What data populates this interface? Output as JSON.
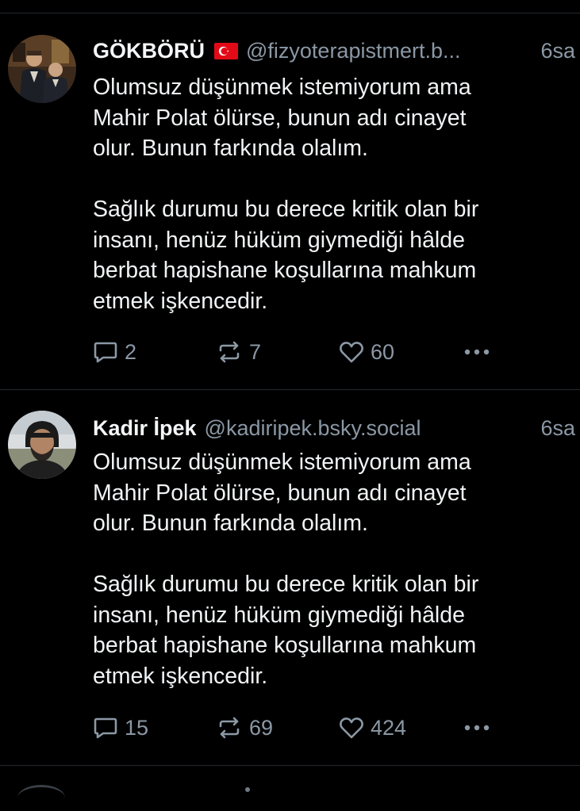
{
  "colors": {
    "background": "#000000",
    "text": "#f1f3f5",
    "muted": "#8b98a5",
    "divider": "#23282d"
  },
  "posts": [
    {
      "author_name": "GÖKBÖRÜ",
      "author_flag": "turkey-flag-icon",
      "handle": "@fizyoterapistmert.b...",
      "time": "6sa",
      "paragraphs": [
        "Olumsuz düşünmek istemiyorum ama\nMahir Polat ölürse, bunun adı cinayet\nolur. Bunun farkında olalım.",
        "Sağlık durumu bu derece kritik olan bir\ninsanı, henüz hüküm giymediği hâlde\nberbat hapishane koşullarına mahkum\netmek işkencedir."
      ],
      "replies": "2",
      "reposts": "7",
      "likes": "60",
      "icons": [
        "reply-icon",
        "repost-icon",
        "like-icon",
        "more-icon"
      ]
    },
    {
      "author_name": "Kadir İpek",
      "handle": "@kadiripek.bsky.social",
      "time": "6sa",
      "paragraphs": [
        "Olumsuz düşünmek istemiyorum ama\nMahir Polat ölürse, bunun adı cinayet\nolur. Bunun farkında olalım.",
        "Sağlık durumu bu derece kritik olan bir\ninsanı, henüz hüküm giymediği hâlde\nberbat hapishane koşullarına mahkum\netmek işkencedir."
      ],
      "replies": "15",
      "reposts": "69",
      "likes": "424",
      "icons": [
        "reply-icon",
        "repost-icon",
        "like-icon",
        "more-icon"
      ]
    }
  ]
}
